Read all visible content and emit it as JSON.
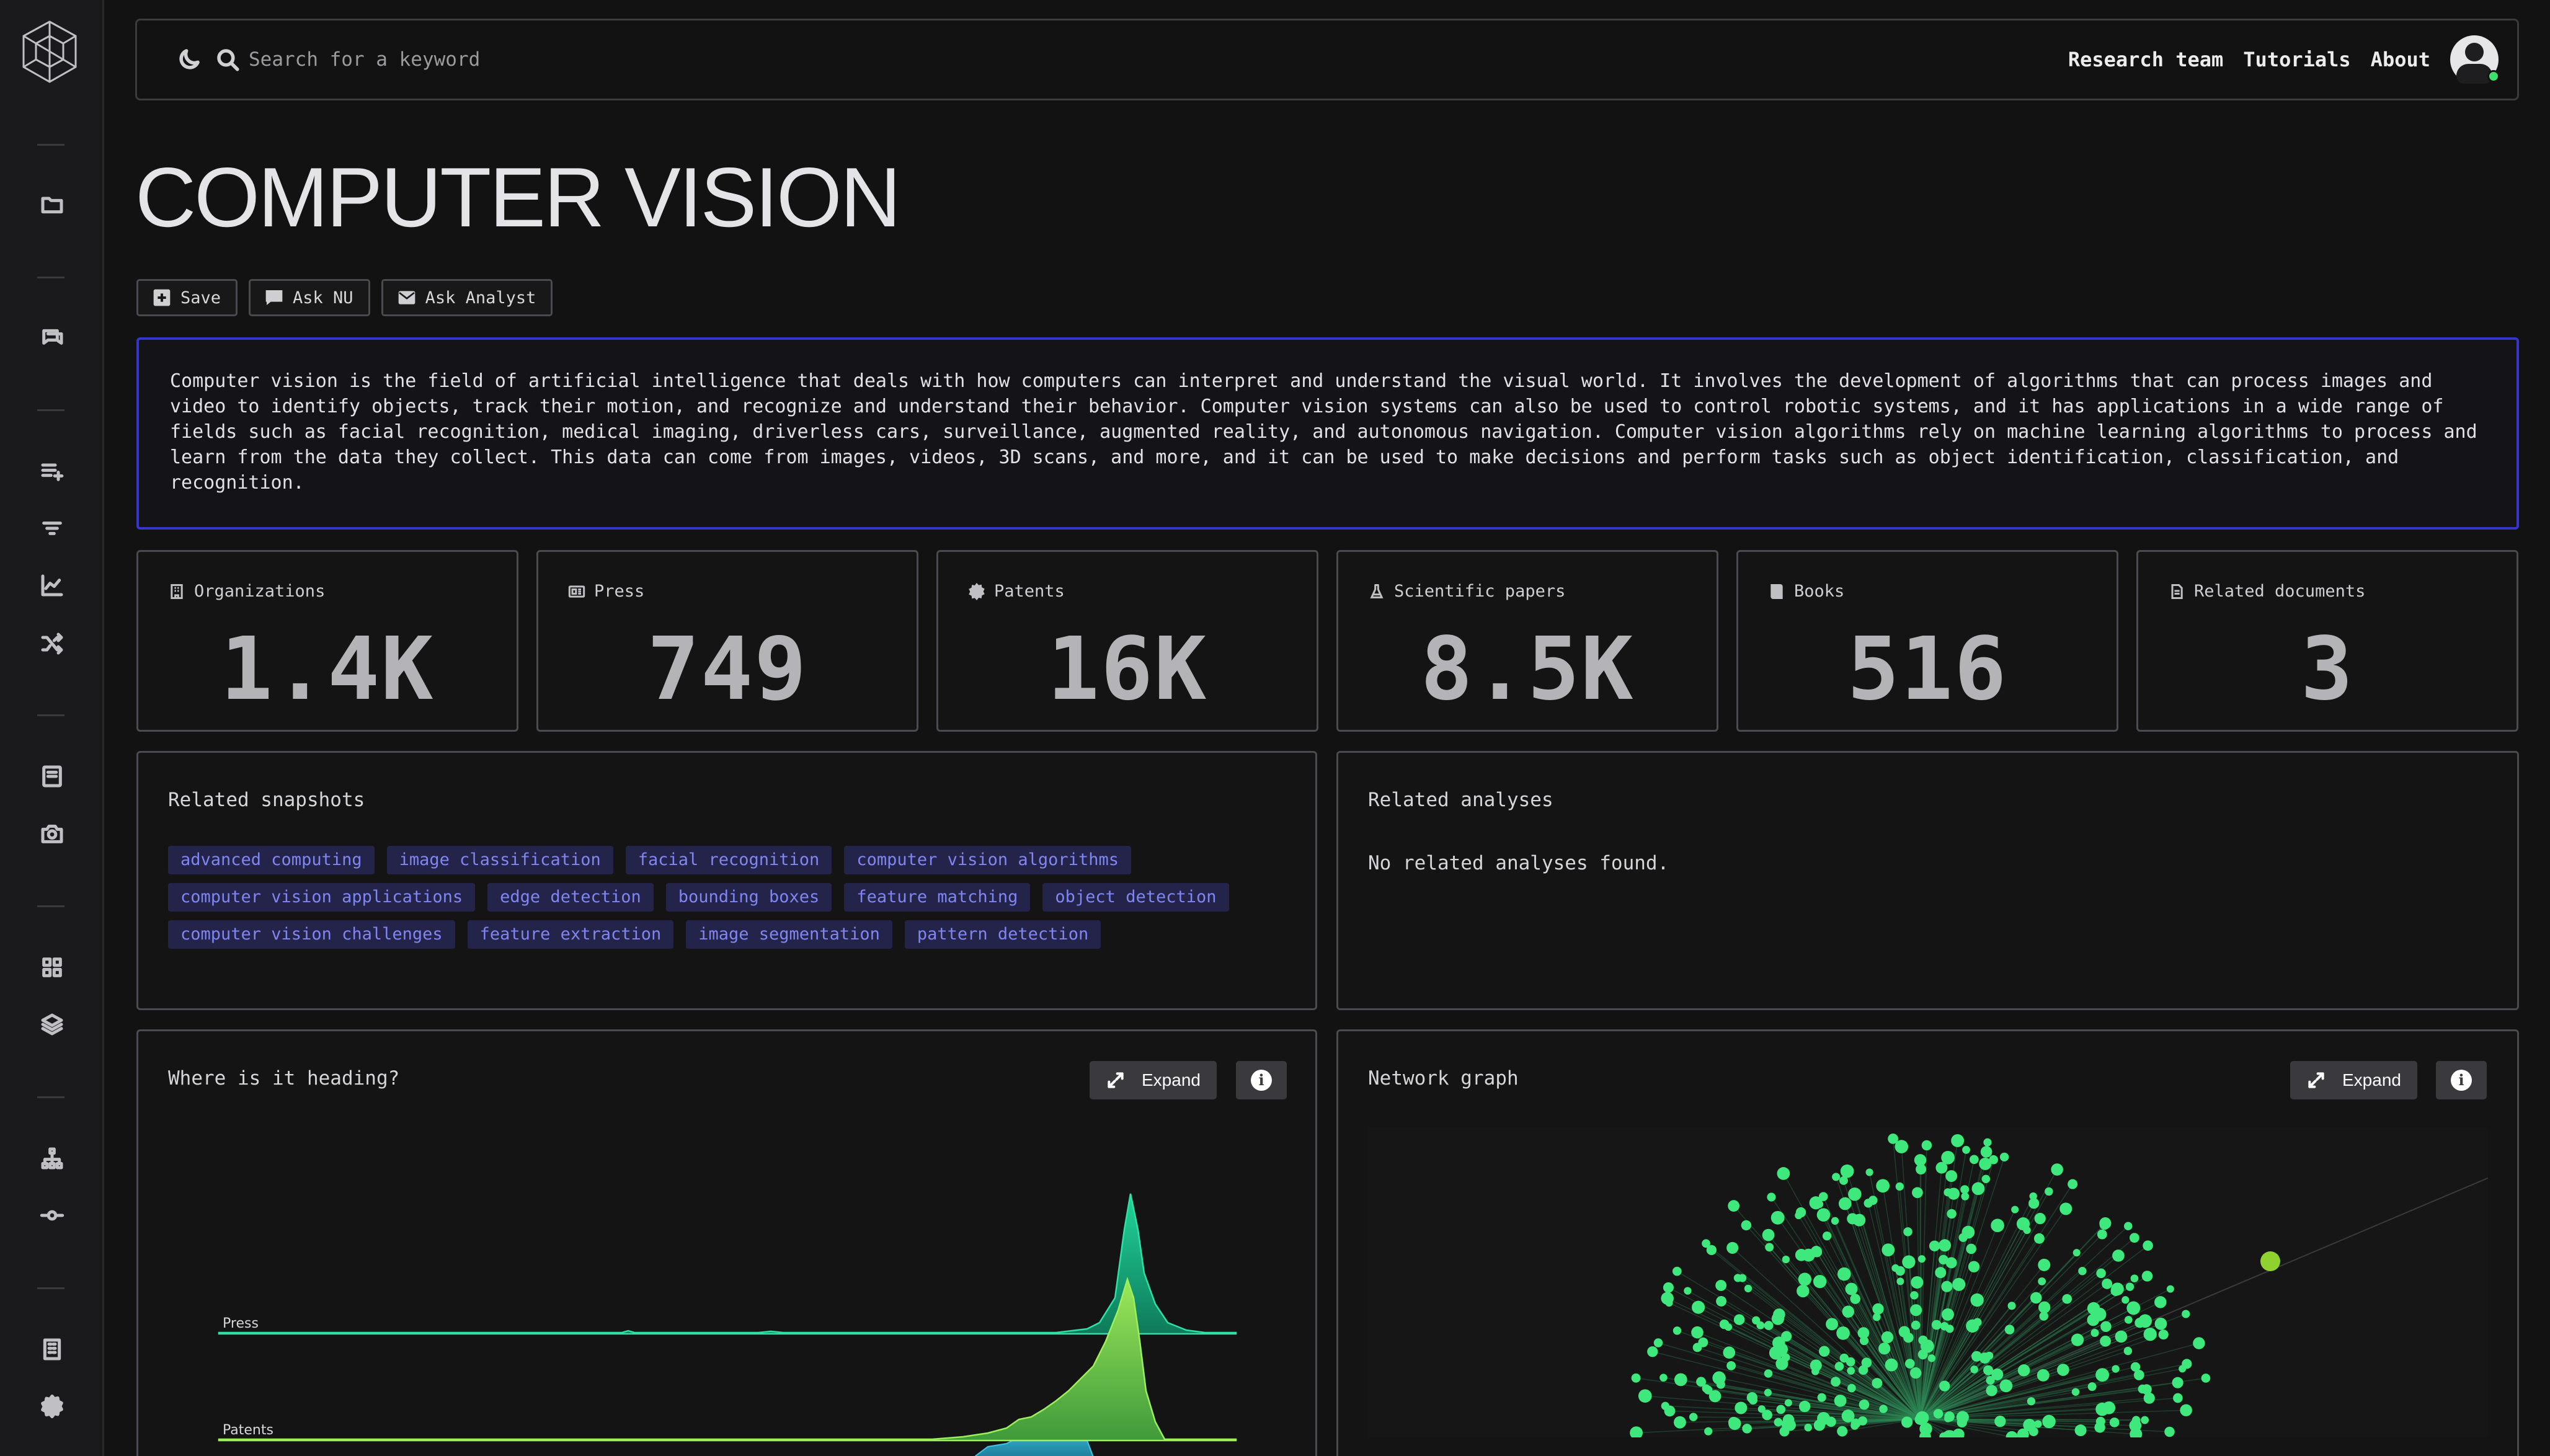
{
  "search": {
    "placeholder": "Search for a keyword"
  },
  "nav": {
    "links": [
      "Research team",
      "Tutorials",
      "About"
    ]
  },
  "title": "COMPUTER VISION",
  "actions": {
    "save": "Save",
    "ask_nu": "Ask NU",
    "ask_analyst": "Ask Analyst"
  },
  "description": "Computer vision is the field of artificial intelligence that deals with how computers can interpret and understand the visual world. It involves the development of algorithms that can process images and video to identify objects, track their motion, and recognize and understand their behavior. Computer vision systems can also be used to control robotic systems, and it has applications in a wide range of fields such as facial recognition, medical imaging, driverless cars, surveillance, augmented reality, and autonomous navigation. Computer vision algorithms rely on machine learning algorithms to process and learn from the data they collect. This data can come from images, videos, 3D scans, and more, and it can be used to make decisions and perform tasks such as object identification, classification, and recognition.",
  "stats": [
    {
      "label": "Organizations",
      "value": "1.4K",
      "icon": "building-icon"
    },
    {
      "label": "Press",
      "value": "749",
      "icon": "newspaper-icon"
    },
    {
      "label": "Patents",
      "value": "16K",
      "icon": "seal-icon"
    },
    {
      "label": "Scientific papers",
      "value": "8.5K",
      "icon": "flask-icon"
    },
    {
      "label": "Books",
      "value": "516",
      "icon": "book-icon"
    },
    {
      "label": "Related documents",
      "value": "3",
      "icon": "document-icon"
    }
  ],
  "snapshots": {
    "title": "Related snapshots",
    "tags": [
      "advanced computing",
      "image classification",
      "facial recognition",
      "computer vision algorithms",
      "computer vision applications",
      "edge detection",
      "bounding boxes",
      "feature matching",
      "object detection",
      "computer vision challenges",
      "feature extraction",
      "image segmentation",
      "pattern detection"
    ]
  },
  "analyses": {
    "title": "Related analyses",
    "empty": "No related analyses found."
  },
  "heading_panel": {
    "title": "Where is it heading?",
    "expand": "Expand"
  },
  "network_panel": {
    "title": "Network graph",
    "expand": "Expand"
  },
  "colors": {
    "accent": "#3636c8",
    "chip_bg": "#24244a",
    "chip_text": "#7f86f2",
    "press": "#1ec98b",
    "patents": "#7dd84a",
    "node": "#3ee87c"
  },
  "chart_data": {
    "type": "area",
    "series": [
      {
        "name": "Press"
      },
      {
        "name": "Patents"
      }
    ]
  }
}
